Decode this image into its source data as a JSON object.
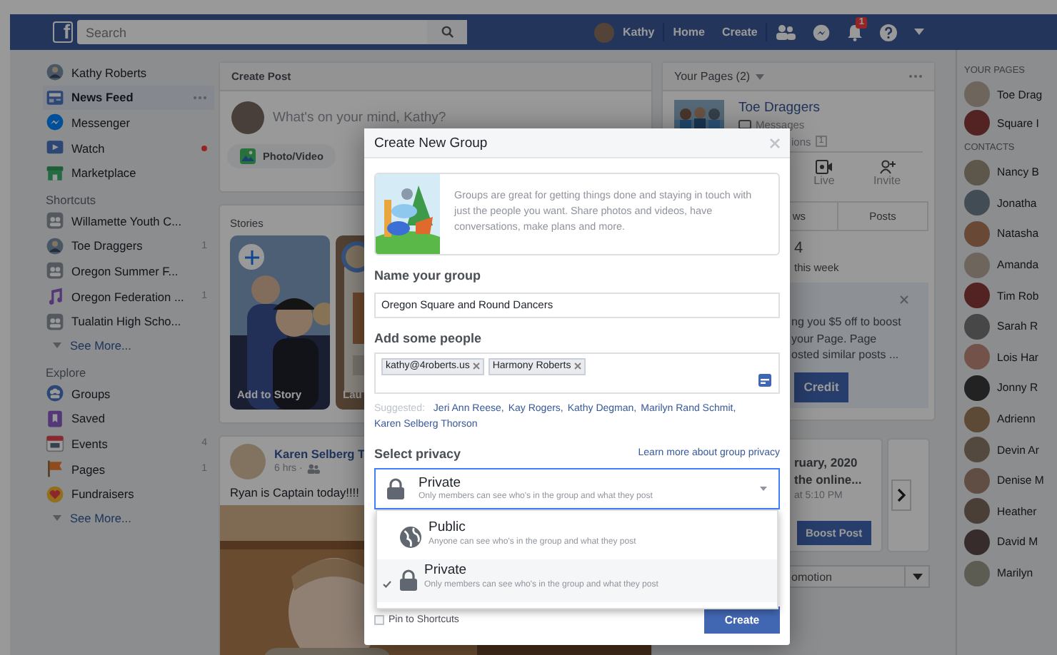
{
  "topbar": {
    "logo": "f",
    "search_placeholder": "Search",
    "user_name": "Kathy",
    "nav": [
      "Home",
      "Create"
    ],
    "notification_count": "1"
  },
  "sidebar": {
    "profile_name": "Kathy Roberts",
    "main": [
      {
        "label": "News Feed",
        "selected": true,
        "unread": false
      },
      {
        "label": "Messenger",
        "selected": false,
        "unread": false
      },
      {
        "label": "Watch",
        "selected": false,
        "unread": true
      },
      {
        "label": "Marketplace",
        "selected": false,
        "unread": false
      }
    ],
    "sections": [
      {
        "title": "Shortcuts",
        "see_more": "See More...",
        "items": [
          {
            "label": "Willamette Youth C...",
            "selected": false
          },
          {
            "label": "Toe Draggers",
            "count": "1",
            "selected": false
          },
          {
            "label": "Oregon Summer F...",
            "selected": false
          },
          {
            "label": "Oregon Federation ...",
            "count": "1",
            "selected": false
          },
          {
            "label": "Tualatin High Scho...",
            "selected": false
          }
        ]
      },
      {
        "title": "Explore",
        "see_more": "See More...",
        "items": [
          {
            "label": "Groups",
            "selected": false
          },
          {
            "label": "Saved",
            "selected": false
          },
          {
            "label": "Events",
            "count": "4",
            "selected": false
          },
          {
            "label": "Pages",
            "count": "1",
            "selected": false
          },
          {
            "label": "Fundraisers",
            "selected": false
          }
        ]
      }
    ]
  },
  "center": {
    "create_post": {
      "title": "Create Post",
      "placeholder": "What's on your mind, Kathy?",
      "action": "Photo/Video"
    },
    "stories": {
      "title": "Stories",
      "tiles": [
        "Add to Story",
        "Lau"
      ]
    },
    "post": {
      "author": "Karen Selberg T",
      "time": "6 hrs ·",
      "text": "Ryan is Captain today!!!!"
    }
  },
  "right": {
    "pages_card": {
      "title": "Your Pages (2)",
      "page_name": "Toe Draggers",
      "messages": "Messages",
      "notifications": "ions",
      "notifications_count": "1",
      "actions": [
        "Live",
        "Invite"
      ],
      "tabs": [
        {
          "label": "ws",
          "selected": false
        },
        {
          "label": "Posts",
          "selected": false
        }
      ],
      "stat": "4",
      "stat_caption": "this week"
    },
    "promo": {
      "lines": [
        "ng you $5 off to boost",
        "your Page. Page",
        "osted similar posts ..."
      ],
      "button": "Credit"
    },
    "event": {
      "lines": [
        "ruary, 2020",
        "the online..."
      ],
      "time": "at 5:10 PM",
      "button": "Boost Post",
      "select": "omotion"
    }
  },
  "contacts": {
    "pages_title": "YOUR PAGES",
    "pages": [
      "Toe Drag",
      "Square I"
    ],
    "contacts_title": "CONTACTS",
    "people": [
      "Nancy B",
      "Jonatha",
      "Natasha",
      "Amanda",
      "Tim Rob",
      "Sarah R",
      "Lois Har",
      "Jonny R",
      "Adrienn",
      "Devin Ar",
      "Denise M",
      "Heather",
      "David M",
      "Marilyn"
    ]
  },
  "modal": {
    "title": "Create New Group",
    "intro": "Groups are great for getting things done and staying in touch with just the people you want. Share photos and videos, have conversations, make plans and more.",
    "name_label": "Name your group",
    "name_value": "Oregon Square and Round Dancers",
    "people_label": "Add some people",
    "people": [
      "kathy@4roberts.us",
      "Harmony Roberts"
    ],
    "suggested_label": "Suggested:",
    "suggested": [
      "Jeri Ann Reese,",
      "Kay Rogers,",
      "Kathy Degman,",
      "Marilyn Rand Schmit,",
      "Karen Selberg Thorson"
    ],
    "privacy_label": "Select privacy",
    "privacy_link": "Learn more about group privacy",
    "privacy_value": {
      "kind": "lock",
      "label": "Private",
      "description": "Only members can see who's in the group and what they post"
    },
    "privacy_options": [
      {
        "kind": "globe",
        "label": "Public",
        "description": "Anyone can see who's in the group and what they post",
        "selected": false
      },
      {
        "kind": "lock",
        "label": "Private",
        "description": "Only members can see who's in the group and what they post",
        "selected": true
      }
    ],
    "pin": {
      "label": "Pin to Shortcuts",
      "checked": false
    },
    "create_button": "Create"
  }
}
